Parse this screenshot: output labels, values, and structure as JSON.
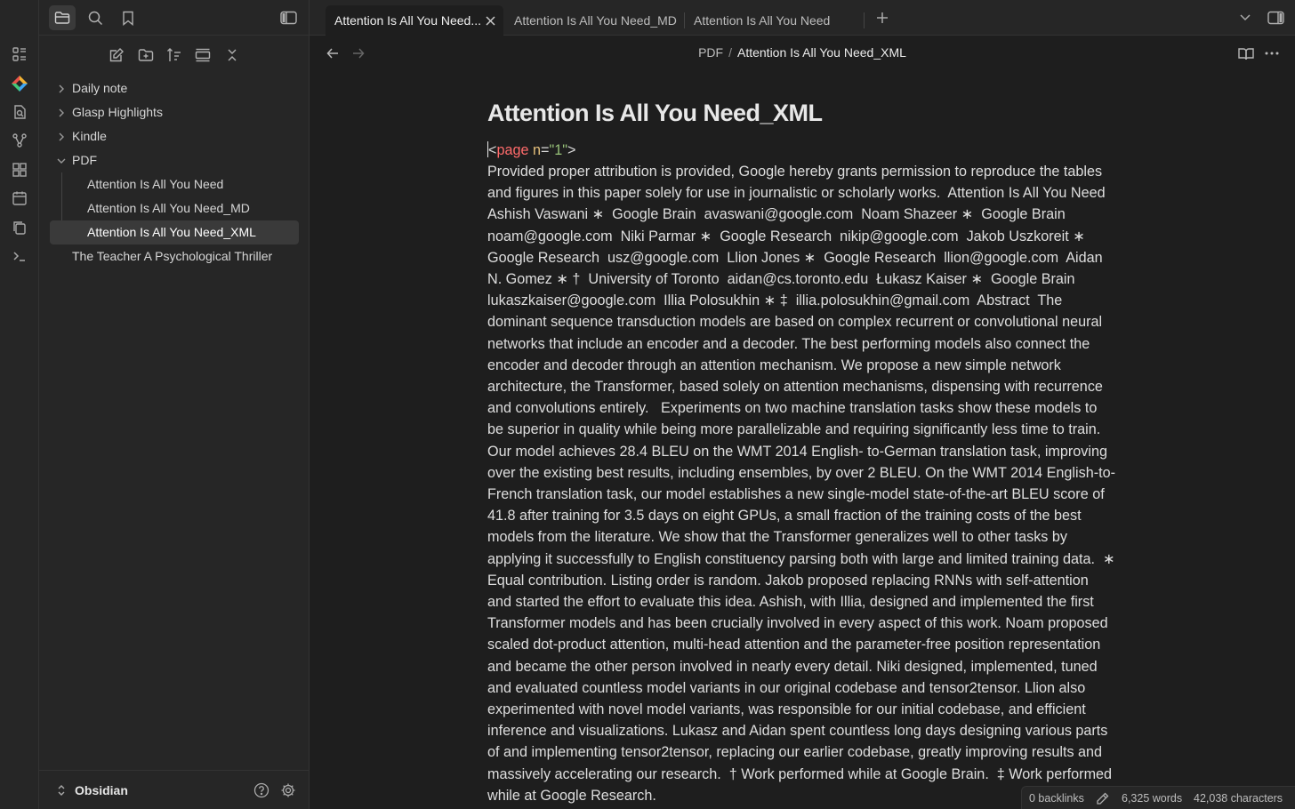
{
  "tabs": [
    {
      "label": "Attention Is All You Need...",
      "active": true
    },
    {
      "label": "Attention Is All You Need_MD",
      "active": false
    },
    {
      "label": "Attention Is All You Need",
      "active": false
    }
  ],
  "breadcrumb": {
    "parent": "PDF",
    "separator": "/",
    "current": "Attention Is All You Need_XML"
  },
  "tree": {
    "items": [
      {
        "label": "Daily note"
      },
      {
        "label": "Glasp Highlights"
      },
      {
        "label": "Kindle"
      },
      {
        "label": "PDF"
      },
      {
        "label": "Attention Is All You Need"
      },
      {
        "label": "Attention Is All You Need_MD"
      },
      {
        "label": "Attention Is All You Need_XML"
      },
      {
        "label": "The Teacher A Psychological Thriller"
      }
    ]
  },
  "vault": {
    "name": "Obsidian"
  },
  "document": {
    "title": "Attention Is All You Need_XML",
    "code": {
      "lt": "<",
      "tag": "page",
      "attr": " n",
      "eq": "=",
      "val": "\"1\"",
      "gt": ">"
    },
    "body": "Provided proper attribution is provided, Google hereby grants permission to reproduce the tables and figures in this paper solely for use in journalistic or scholarly works.  Attention Is All You Need  Ashish Vaswani ∗  Google Brain  avaswani@google.com  Noam Shazeer ∗  Google Brain  noam@google.com  Niki Parmar ∗  Google Research  nikip@google.com  Jakob Uszkoreit ∗  Google Research  usz@google.com  Llion Jones ∗  Google Research  llion@google.com  Aidan N. Gomez ∗ †  University of Toronto  aidan@cs.toronto.edu  Łukasz Kaiser ∗  Google Brain  lukaszkaiser@google.com  Illia Polosukhin ∗ ‡  illia.polosukhin@gmail.com  Abstract  The dominant sequence transduction models are based on complex recurrent or convolutional neural networks that include an encoder and a decoder. The best performing models also connect the encoder and decoder through an attention mechanism. We propose a new simple network architecture, the Transformer, based solely on attention mechanisms, dispensing with recurrence and convolutions entirely.   Experiments on two machine translation tasks show these models to be superior in quality while being more parallelizable and requiring significantly less time to train. Our model achieves 28.4 BLEU on the WMT 2014 English- to-German translation task, improving over the existing best results, including ensembles, by over 2 BLEU. On the WMT 2014 English-to-French translation task, our model establishes a new single-model state-of-the-art BLEU score of 41.8 after training for 3.5 days on eight GPUs, a small fraction of the training costs of the best models from the literature. We show that the Transformer generalizes well to other tasks by applying it successfully to English constituency parsing both with large and limited training data.  ∗ Equal contribution. Listing order is random. Jakob proposed replacing RNNs with self-attention and started the effort to evaluate this idea. Ashish, with Illia, designed and implemented the first Transformer models and has been crucially involved in every aspect of this work. Noam proposed scaled dot-product attention, multi-head attention and the parameter-free position representation and became the other person involved in nearly every detail. Niki designed, implemented, tuned and evaluated countless model variants in our original codebase and tensor2tensor. Llion also experimented with novel model variants, was responsible for our initial codebase, and efficient inference and visualizations. Lukasz and Aidan spent countless long days designing various parts of and implementing tensor2tensor, replacing our earlier codebase, greatly improving results and massively accelerating our research.  † Work performed while at Google Brain.  ‡ Work performed while at Google Research."
  },
  "status": {
    "backlinks": "0 backlinks",
    "words": "6,325 words",
    "characters": "42,038 characters"
  },
  "icons": {
    "ribbon": [
      "dashboard-icon",
      "glasp-logo-icon",
      "file-search-icon",
      "graph-icon",
      "plugins-icon",
      "calendar-icon",
      "copy-icon",
      "terminal-icon"
    ],
    "sidebar_top": [
      "folder-icon",
      "search-icon",
      "bookmark-icon",
      "sidebar-toggle-icon"
    ],
    "sidebar_tools": [
      "new-note-icon",
      "new-folder-icon",
      "sort-icon",
      "collapse-view-icon",
      "collapse-all-icon"
    ]
  },
  "colors": {
    "accent_logo": [
      "#f2b233",
      "#e8524a",
      "#3fa7f5",
      "#40c878"
    ],
    "xml_tag": "#ff6b6b",
    "xml_attr": "#e6c07b",
    "xml_value": "#98c379"
  }
}
